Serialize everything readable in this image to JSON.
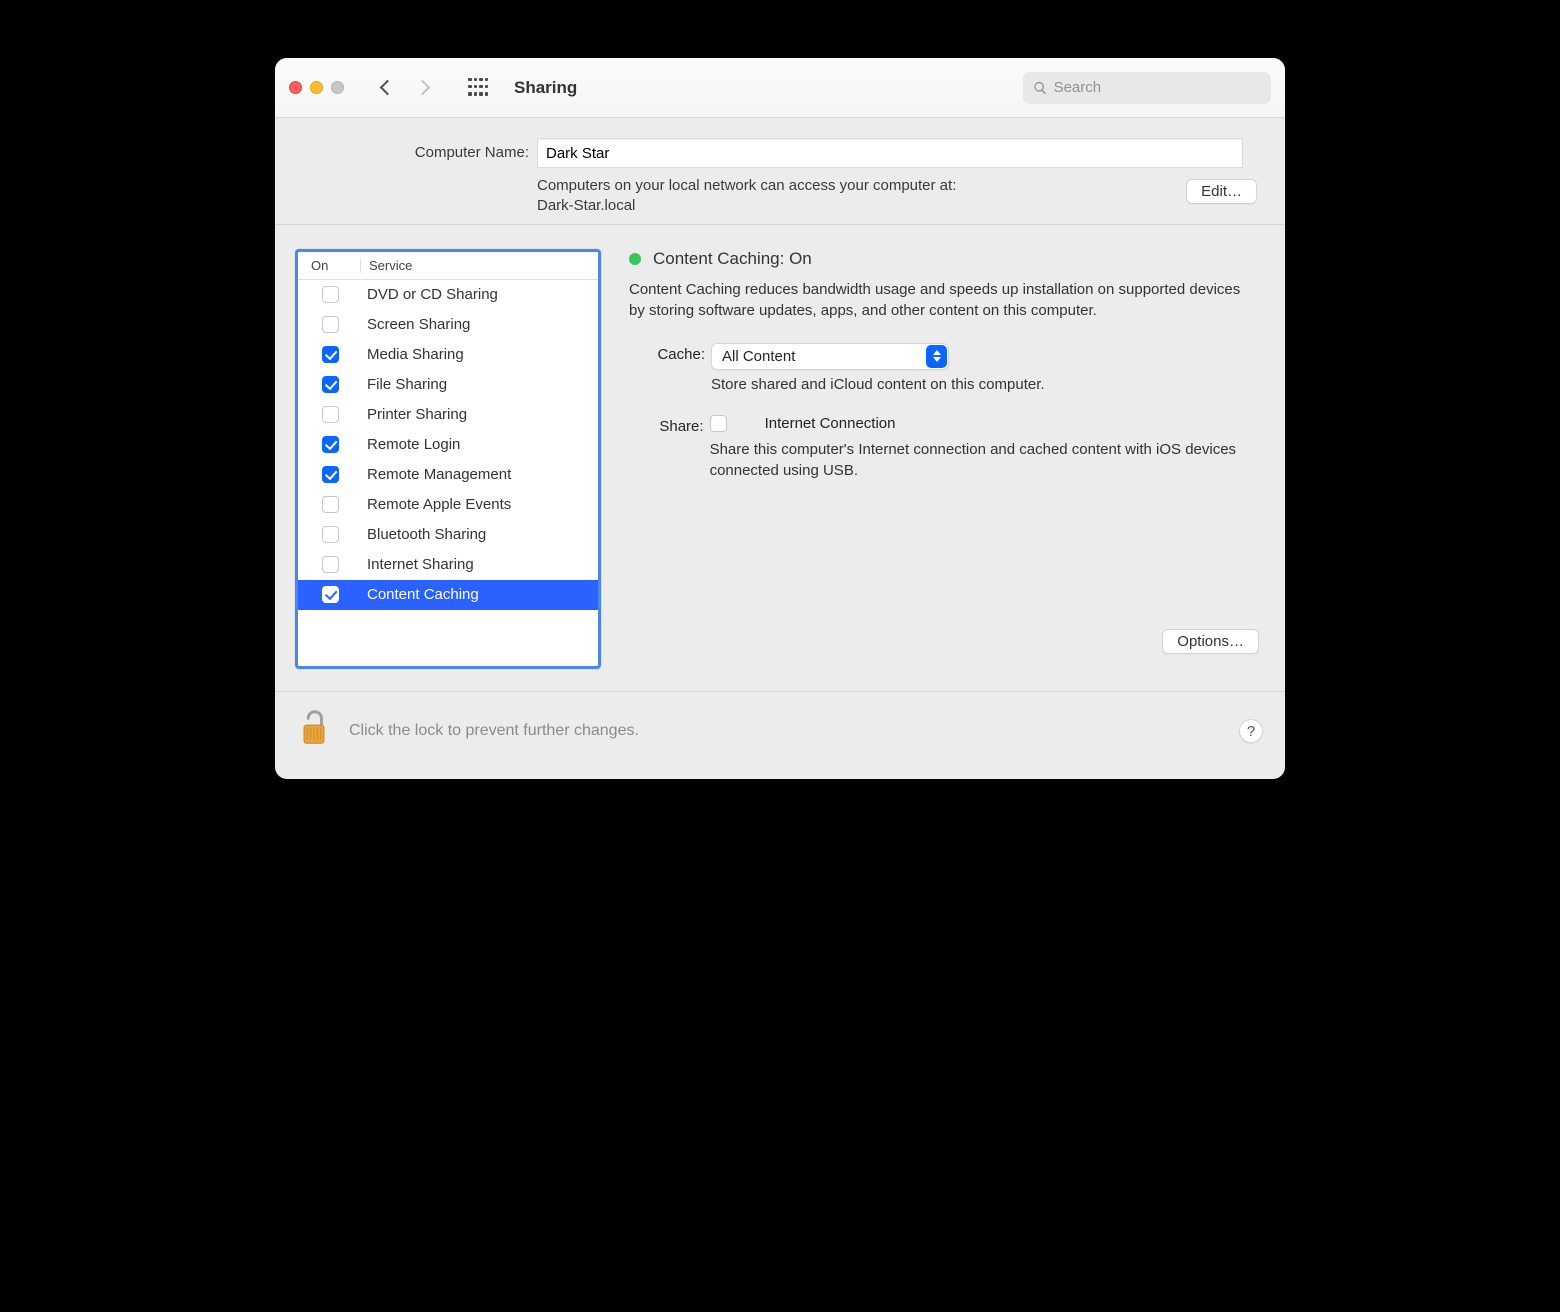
{
  "toolbar": {
    "title": "Sharing",
    "search_placeholder": "Search"
  },
  "header": {
    "computer_name_label": "Computer Name:",
    "computer_name": "Dark Star",
    "access_text_line1": "Computers on your local network can access your computer at:",
    "access_text_line2": "Dark-Star.local",
    "edit_label": "Edit…"
  },
  "list": {
    "col_on": "On",
    "col_service": "Service",
    "services": [
      {
        "label": "DVD or CD Sharing",
        "on": false,
        "selected": false
      },
      {
        "label": "Screen Sharing",
        "on": false,
        "selected": false
      },
      {
        "label": "Media Sharing",
        "on": true,
        "selected": false
      },
      {
        "label": "File Sharing",
        "on": true,
        "selected": false
      },
      {
        "label": "Printer Sharing",
        "on": false,
        "selected": false
      },
      {
        "label": "Remote Login",
        "on": true,
        "selected": false
      },
      {
        "label": "Remote Management",
        "on": true,
        "selected": false
      },
      {
        "label": "Remote Apple Events",
        "on": false,
        "selected": false
      },
      {
        "label": "Bluetooth Sharing",
        "on": false,
        "selected": false
      },
      {
        "label": "Internet Sharing",
        "on": false,
        "selected": false
      },
      {
        "label": "Content Caching",
        "on": true,
        "selected": true
      }
    ]
  },
  "detail": {
    "status_title": "Content Caching: On",
    "description": "Content Caching reduces bandwidth usage and speeds up installation on supported devices by storing software updates, apps, and other content on this computer.",
    "cache_label": "Cache:",
    "cache_value": "All Content",
    "cache_hint": "Store shared and iCloud content on this computer.",
    "share_label": "Share:",
    "share_option": "Internet Connection",
    "share_checked": false,
    "share_hint": "Share this computer's Internet connection and cached content with iOS devices connected using USB.",
    "options_label": "Options…"
  },
  "footer": {
    "lock_text": "Click the lock to prevent further changes.",
    "help_label": "?"
  }
}
